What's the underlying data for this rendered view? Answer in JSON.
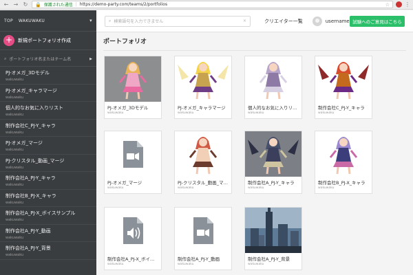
{
  "browser": {
    "secure_label": "保護された通信",
    "url": "https://demo-party.com/teams/2/portfolios"
  },
  "sidebar": {
    "top_label": "TOP",
    "team_name": "WAKUWAKU",
    "create_label": "新規ポートフォリオ作成",
    "search_placeholder": "ポートフォリオ名またはチーム名",
    "items": [
      {
        "label": "PJ-オメガ_3Dモデル",
        "team": "wakuwaku"
      },
      {
        "label": "PJ-オメガ_キャラマージ",
        "team": "wakuwaku"
      },
      {
        "label": "個人的なお気に入りリスト",
        "team": "wakuwaku"
      },
      {
        "label": "制作会社C_PJ-Y_キャラ",
        "team": "wakuwaku"
      },
      {
        "label": "PJ-オメガ_マージ",
        "team": "wakuwaku"
      },
      {
        "label": "PJ-クリスタル_動画_マージ",
        "team": "wakuwaku"
      },
      {
        "label": "制作会社A_PJ-Y_キャラ",
        "team": "wakuwaku"
      },
      {
        "label": "制作会社B_PJ-X_キャラ",
        "team": "wakuwaku"
      },
      {
        "label": "制作会社A_PJ-X_ボイスサンプル",
        "team": "wakuwaku"
      },
      {
        "label": "制作会社A_PJ-Y_動画",
        "team": "wakuwaku"
      },
      {
        "label": "制作会社A_PJ-Y_背景",
        "team": "wakuwaku"
      }
    ]
  },
  "header": {
    "search_placeholder": "検索語句を入力できません",
    "creator_list": "クリエイター一覧",
    "username": "username",
    "opinion_button": "試験へのご意見はこちら"
  },
  "main": {
    "title": "ポートフォリオ",
    "cards": [
      {
        "title": "PJ-オメガ_3Dモデル",
        "team": "wakuwaku",
        "thumb": "character-3d"
      },
      {
        "title": "PJ-オメガ_キャラマージ",
        "team": "wakuwaku",
        "thumb": "character-blonde"
      },
      {
        "title": "個人的なお気に入りリスト",
        "team": "wakuwaku",
        "thumb": "character-girl"
      },
      {
        "title": "制作会社C_PJ-Y_キャラ",
        "team": "wakuwaku",
        "thumb": "character-dragon"
      },
      {
        "title": "PJ-オメガ_マージ",
        "team": "wakuwaku",
        "thumb": "video-file-icon"
      },
      {
        "title": "PJ-クリスタル_動画_マージ",
        "team": "wakuwaku",
        "thumb": "character-fighter"
      },
      {
        "title": "制作会社A_PJ-Y_キャラ",
        "team": "wakuwaku",
        "thumb": "character-armored"
      },
      {
        "title": "制作会社B_PJ-X_キャラ",
        "team": "wakuwaku",
        "thumb": "character-mage"
      },
      {
        "title": "制作会社A_PJ-X_ボイスサンプル",
        "team": "wakuwaku",
        "thumb": "audio-file-icon"
      },
      {
        "title": "制作会社A_PJ-Y_動画",
        "team": "wakuwaku",
        "thumb": "video-file-icon"
      },
      {
        "title": "制作会社A_PJ-Y_背景",
        "team": "wakuwaku",
        "thumb": "background-city"
      }
    ]
  },
  "colors": {
    "sidebar_bg": "#3a3d40",
    "accent_pink": "#e54d86",
    "accent_green": "#2bbf6a",
    "file_icon": "#8a9199"
  }
}
